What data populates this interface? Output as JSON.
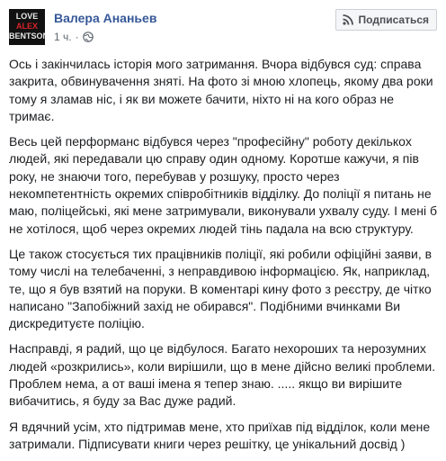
{
  "post": {
    "author": "Валера Ананьев",
    "time": "1 ч.",
    "dot": "·",
    "subscribe_label": "Подписаться",
    "avatar_lines": [
      "LOVE",
      "ALEX",
      "BENTSON"
    ],
    "paragraphs": [
      "Ось і закінчилась історія мого затримання. Вчора відбувся суд: справа закрита, обвинувачення зняті. На фото зі мною хлопець, якому два роки тому я зламав ніс, і як ви можете бачити, ніхто ні на кого образ не тримає.",
      "Весь цей перформанс відбувся через \"професійну\" роботу декількох людей, які передавали цю справу один одному. Коротше кажучи, я пів року, не знаючи того, перебував у розшуку, просто через некомпетентність окремих співробітників відділку. До поліції я питань не маю, поліцейські, які мене затримували, виконували ухвалу суду. І мені б не хотілося, щоб через окремих людей тінь падала на всю структуру.",
      "Це також стосується тих працівників поліції, які робили офіційні заяви, в тому числі на телебаченні, з неправдивою інформацією. Як, наприклад, те, що я був взятий на поруки. В коментарі кину фото з реєстру, де чітко написано \"Запобіжний захід не обирався\". Подібними вчинками Ви дискредитуєте поліцію.",
      "Насправді, я радий, що це відбулося. Багато нехороших та нерозумних людей «розкрились», коли вирішили, що в мене дійсно великі проблеми. Проблем нема, а от ваші імена я тепер знаю. ..... якщо ви вирішите вибачитись, я буду за Вас дуже радий.",
      "Я вдячний усім, хто підтримав мене, хто приїхав під відділок, коли мене затримали. Підписувати книги через решітку, це унікальний досвід )"
    ]
  }
}
